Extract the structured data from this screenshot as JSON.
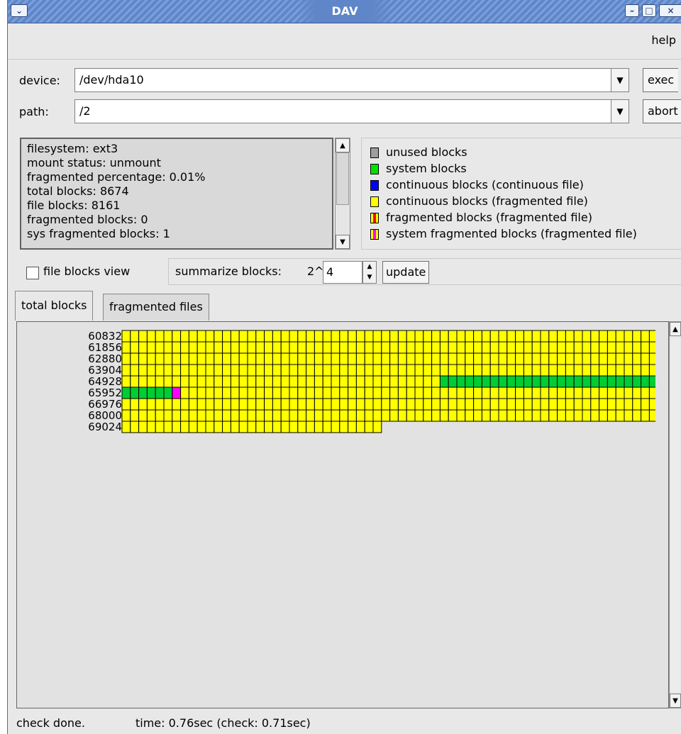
{
  "window": {
    "title": "DAV"
  },
  "menu": {
    "help": "help"
  },
  "device": {
    "label": "device:",
    "value": "/dev/hda10",
    "exec_label": "exec"
  },
  "path": {
    "label": "path:",
    "value": "/2",
    "abort_label": "abort"
  },
  "info": {
    "lines": [
      "filesystem: ext3",
      "mount status: unmount",
      "fragmented percentage: 0.01%",
      "total blocks: 8674",
      "file blocks: 8161",
      "fragmented blocks: 0",
      "sys fragmented blocks: 1"
    ]
  },
  "legend": [
    {
      "label": "unused blocks",
      "color": "#9e9e9e"
    },
    {
      "label": "system blocks",
      "color": "#00e000"
    },
    {
      "label": "continuous blocks (continuous file)",
      "color": "#0000ff"
    },
    {
      "label": "continuous blocks (fragmented file)",
      "color": "#ffff00"
    },
    {
      "label": "fragmented blocks (fragmented file)",
      "color": "#ff0000",
      "color2": "#ffff00"
    },
    {
      "label": "system fragmented blocks (fragmented file)",
      "color": "#ff00ff",
      "color2": "#ffff00"
    }
  ],
  "controls": {
    "file_blocks_view": "file blocks view",
    "file_blocks_checked": false,
    "summarize_label": "summarize blocks:",
    "base": "2^",
    "exponent": "4",
    "update_label": "update"
  },
  "tabs": [
    {
      "label": "total blocks",
      "active": true
    },
    {
      "label": "fragmented files",
      "active": false
    }
  ],
  "block_map": {
    "row_labels": [
      "60832",
      "61856",
      "62880",
      "63904",
      "64928",
      "65952",
      "66976",
      "68000",
      "69024"
    ],
    "columns": 64,
    "last_row_cells": 31,
    "colors": {
      "yellow": "#ffff00",
      "green": "#00cc33",
      "magenta": "#ff00ff"
    },
    "green_runs": [
      {
        "row": 4,
        "from": 38,
        "to": 63
      },
      {
        "row": 5,
        "from": 0,
        "to": 5
      }
    ],
    "magenta_cells": [
      {
        "row": 5,
        "col": 6
      }
    ]
  },
  "status": {
    "message": "check done.",
    "timing": "time: 0.76sec (check: 0.71sec)"
  }
}
